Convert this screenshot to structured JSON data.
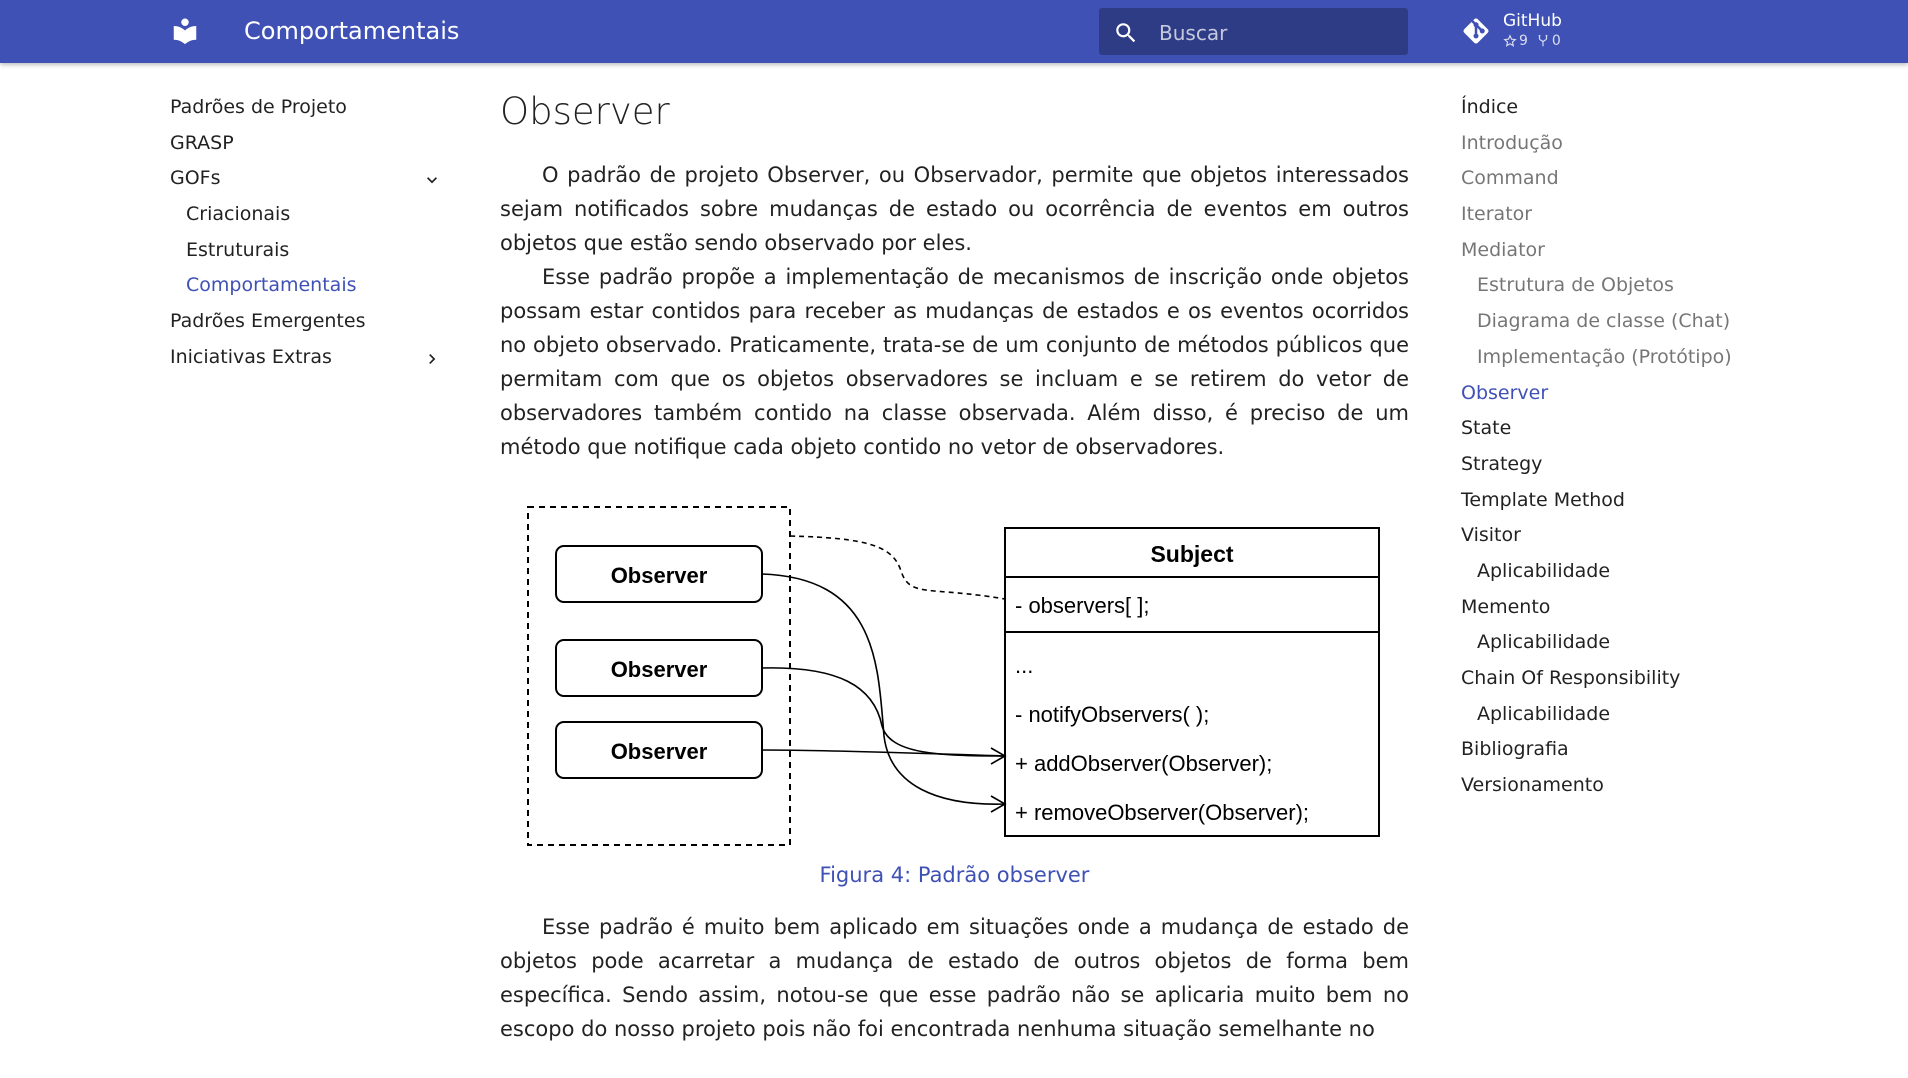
{
  "header": {
    "title": "Comportamentais",
    "search_placeholder": "Buscar",
    "repo": {
      "name": "GitHub",
      "stars": "9",
      "forks": "0"
    }
  },
  "nav": {
    "items": [
      {
        "label": "Padrões de Projeto"
      },
      {
        "label": "GRASP"
      },
      {
        "label": "GOFs"
      },
      {
        "label": "Criacionais"
      },
      {
        "label": "Estruturais"
      },
      {
        "label": "Comportamentais"
      },
      {
        "label": "Padrões Emergentes"
      },
      {
        "label": "Iniciativas Extras"
      }
    ]
  },
  "content": {
    "title": "Observer",
    "paragraphs": [
      "O padrão de projeto Observer, ou Observador, permite que objetos interessados sejam notificados sobre mudanças de estado ou ocorrência de eventos em outros objetos que estão sendo observado por eles.",
      "Esse padrão propõe a implementação de mecanismos de inscrição onde objetos possam estar contidos para receber as mudanças de estados e os eventos ocorridos no objeto observado. Praticamente, trata-se de um conjunto de métodos públicos que permitam com que os objetos observadores se incluam e se retirem do vetor de observadores também contido na classe observada. Além disso, é preciso de um método que notifique cada objeto contido no vetor de observadores.",
      "Esse padrão é muito bem aplicado em situações onde a mudança de estado de objetos pode acarretar a mudança de estado de outros objetos de forma bem específica. Sendo assim, notou-se que esse padrão não se aplicaria muito bem no escopo do nosso projeto pois não foi encontrada nenhuma situação semelhante no"
    ],
    "figure": {
      "observers": [
        "Observer",
        "Observer",
        "Observer"
      ],
      "subject_title": "Subject",
      "attribute": "- observers[ ];",
      "methods": [
        "...",
        "- notifyObservers( );",
        "+ addObserver(Observer);",
        "+ removeObserver(Observer);"
      ],
      "caption": "Figura 4: Padrão observer"
    }
  },
  "toc": {
    "title": "Índice",
    "items": [
      {
        "label": "Introdução"
      },
      {
        "label": "Command"
      },
      {
        "label": "Iterator"
      },
      {
        "label": "Mediator"
      },
      {
        "label": "Estrutura de Objetos"
      },
      {
        "label": "Diagrama de classe (Chat)"
      },
      {
        "label": "Implementação (Protótipo)"
      },
      {
        "label": "Observer"
      },
      {
        "label": "State"
      },
      {
        "label": "Strategy"
      },
      {
        "label": "Template Method"
      },
      {
        "label": "Visitor"
      },
      {
        "label": "Aplicabilidade"
      },
      {
        "label": "Memento"
      },
      {
        "label": "Aplicabilidade"
      },
      {
        "label": "Chain Of Responsibility"
      },
      {
        "label": "Aplicabilidade"
      },
      {
        "label": "Bibliografia"
      },
      {
        "label": "Versionamento"
      }
    ]
  }
}
